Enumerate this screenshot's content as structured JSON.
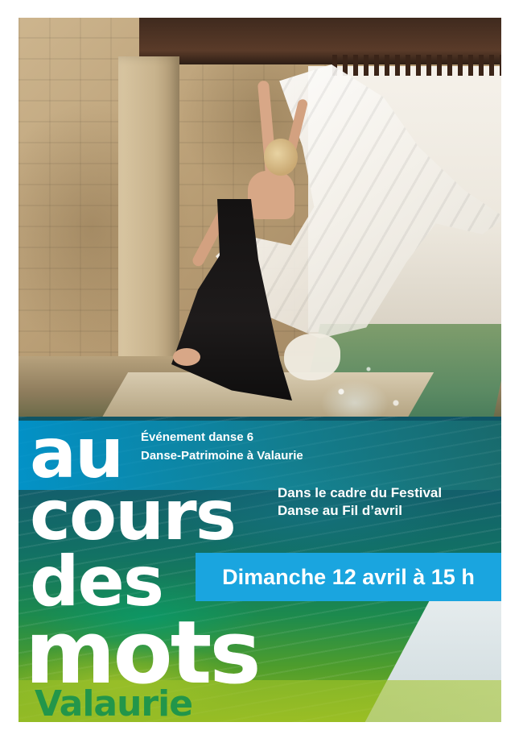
{
  "poster": {
    "title_words": [
      "au",
      "cours",
      "des",
      "mots"
    ],
    "place": "Valaurie",
    "event_line1": "Événement danse 6",
    "event_line2": "Danse-Patrimoine à Valaurie",
    "festival_line1": "Dans le cadre du Festival",
    "festival_line2": "Danse au Fil d’avril",
    "date": "Dimanche 12 avril à 15 h"
  },
  "colors": {
    "accent_cyan": "#1aa5df",
    "title_white": "#ffffff",
    "place_green": "#22964a"
  }
}
